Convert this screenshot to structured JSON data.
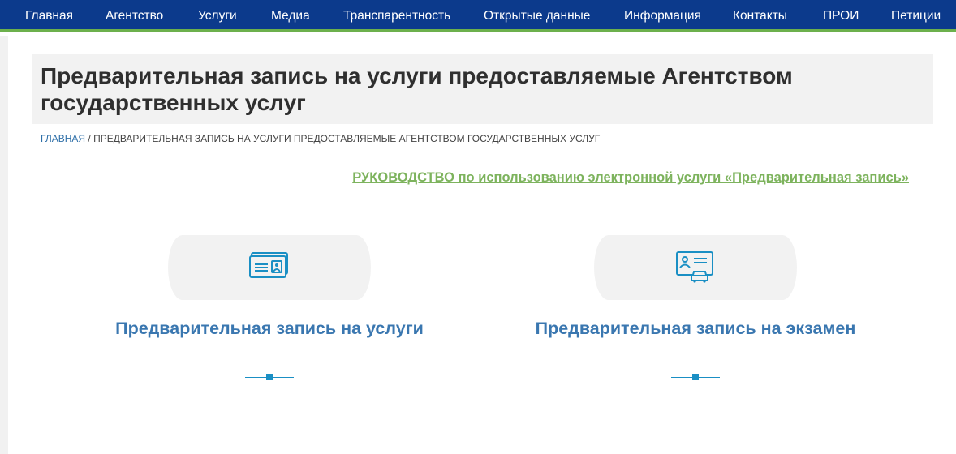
{
  "nav": {
    "items": [
      {
        "label": "Главная"
      },
      {
        "label": "Агентство"
      },
      {
        "label": "Услуги"
      },
      {
        "label": "Медиа"
      },
      {
        "label": "Транспарентность"
      },
      {
        "label": "Открытые данные"
      },
      {
        "label": "Информация"
      },
      {
        "label": "Контакты"
      },
      {
        "label": "ПРОИ"
      },
      {
        "label": "Петиции"
      }
    ]
  },
  "page": {
    "title": "Предварительная запись на услуги предоставляемые Агентством государственных услуг"
  },
  "breadcrumb": {
    "home": "ГЛАВНАЯ",
    "separator": " / ",
    "current": "ПРЕДВАРИТЕЛЬНАЯ ЗАПИСЬ НА УСЛУГИ ПРЕДОСТАВЛЯЕМЫЕ АГЕНТСТВОМ ГОСУДАРСТВЕННЫХ УСЛУГ"
  },
  "guide_link": "РУКОВОДСТВО по использованию электронной услуги «Предварительная запись»",
  "cards": [
    {
      "title": "Предварительная запись на услуги",
      "icon": "id-card-icon"
    },
    {
      "title": "Предварительная запись на экзамен",
      "icon": "driver-license-icon"
    }
  ],
  "colors": {
    "nav_bg": "#0c3a8c",
    "nav_accent": "#6cb04c",
    "link_green": "#7db35d",
    "card_title_blue": "#3a77b0",
    "icon_blue": "#1a8fc4"
  }
}
